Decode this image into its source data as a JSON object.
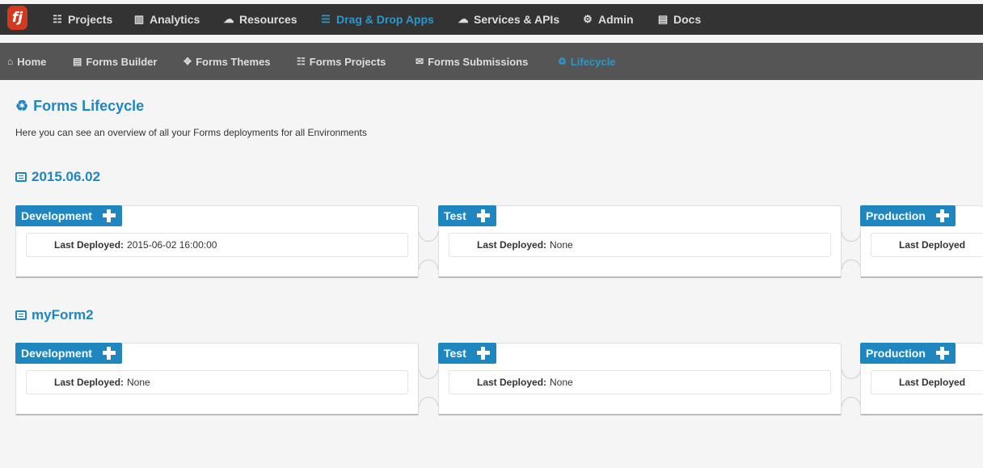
{
  "topnav": {
    "logo": "fj",
    "items": [
      {
        "label": "Projects",
        "icon": "grid-icon"
      },
      {
        "label": "Analytics",
        "icon": "bar-chart-icon"
      },
      {
        "label": "Resources",
        "icon": "cloud-icon"
      },
      {
        "label": "Drag & Drop Apps",
        "icon": "list-icon",
        "active": true
      },
      {
        "label": "Services & APIs",
        "icon": "cloud-upload-icon"
      },
      {
        "label": "Admin",
        "icon": "cogs-icon"
      },
      {
        "label": "Docs",
        "icon": "book-icon"
      }
    ]
  },
  "subnav": {
    "items": [
      {
        "label": "Home",
        "icon": "home-icon"
      },
      {
        "label": "Forms Builder",
        "icon": "list-alt-icon"
      },
      {
        "label": "Forms Themes",
        "icon": "magic-icon"
      },
      {
        "label": "Forms Projects",
        "icon": "grid-icon"
      },
      {
        "label": "Forms Submissions",
        "icon": "envelope-icon"
      },
      {
        "label": "Lifecycle",
        "icon": "recycle-icon",
        "active": true
      }
    ]
  },
  "page": {
    "title": "Forms Lifecycle",
    "intro": "Here you can see an overview of all your Forms deployments for all Environments"
  },
  "forms": [
    {
      "name": "2015.06.02",
      "environments": [
        {
          "name": "Development",
          "label": "Last Deployed:",
          "value": "2015-06-02 16:00:00"
        },
        {
          "name": "Test",
          "label": "Last Deployed:",
          "value": "None"
        },
        {
          "name": "Production",
          "label": "Last Deployed",
          "value": ""
        }
      ]
    },
    {
      "name": "myForm2",
      "environments": [
        {
          "name": "Development",
          "label": "Last Deployed:",
          "value": "None"
        },
        {
          "name": "Test",
          "label": "Last Deployed:",
          "value": "None"
        },
        {
          "name": "Production",
          "label": "Last Deployed",
          "value": ""
        }
      ]
    }
  ],
  "colors": {
    "accent": "#1f86c0",
    "topbar": "#333333",
    "subbar": "#555555",
    "logo": "#d4381f"
  }
}
